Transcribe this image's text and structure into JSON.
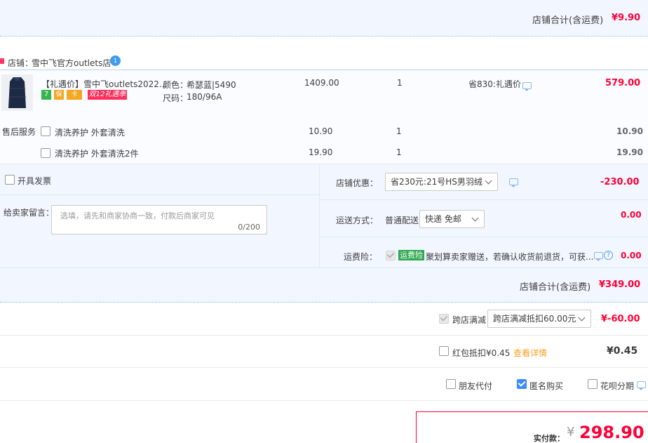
{
  "top_store": {
    "total_label": "店铺合计(含运费)",
    "total_value": "¥9.90"
  },
  "store": {
    "label": "店铺：",
    "name": "雪中飞官方outlets店",
    "ww_badge": "1"
  },
  "product": {
    "title": "【礼遇价】雪中飞outlets2022...",
    "color_label": "颜色：",
    "color_value": "希瑟蓝|5490",
    "size_label": "尺码：",
    "size_value": "180/96A",
    "unit_price": "1409.00",
    "quantity": "1",
    "promo": "省830:礼遇价",
    "subtotal": "579.00",
    "badges": [
      "7",
      "保",
      "卡"
    ],
    "event_badge": "双12礼遇季"
  },
  "after_sales": {
    "label": "售后服务",
    "items": [
      {
        "name": "清洗养护 外套清洗",
        "price": "10.90",
        "qty": "1",
        "total": "10.90"
      },
      {
        "name": "清洗养护 外套清洗2件",
        "price": "19.90",
        "qty": "1",
        "total": "19.90"
      }
    ]
  },
  "invoice": {
    "label": "开具发票"
  },
  "message": {
    "label": "给卖家留言：",
    "placeholder": "选填，请先和商家协商一致，付款后商家可见",
    "counter": "0/200"
  },
  "discount": {
    "label": "店铺优惠：",
    "selected": "省230元:21号HS男羽绒",
    "amount": "-230.00"
  },
  "shipping": {
    "label": "运送方式：",
    "method": "普通配送",
    "selected": "快递 免邮",
    "amount": "0.00"
  },
  "insurance": {
    "label": "运费险：",
    "badge": "运费险",
    "text": "聚划算卖家赠送，若确认收货前退货，可获...",
    "amount": "0.00"
  },
  "store_total": {
    "label": "店铺合计(含运费)",
    "value": "¥349.00"
  },
  "cross_store": {
    "label": "跨店满减",
    "selected": "跨店满减抵扣60.00元",
    "amount": "¥-60.00"
  },
  "red_packet": {
    "label": "红包抵扣¥0.45",
    "link": "查看详情",
    "amount": "¥0.45"
  },
  "options": {
    "friend_pay": "朋友代付",
    "anonymous": "匿名购买",
    "huabei": "花呗分期"
  },
  "payment": {
    "label": "实付款：",
    "currency": "¥",
    "value": "298.90"
  },
  "colors": {
    "accent_red": "#ff0036",
    "band_blue": "#f2f7ff",
    "checkbox_blue": "#3c8cff"
  }
}
